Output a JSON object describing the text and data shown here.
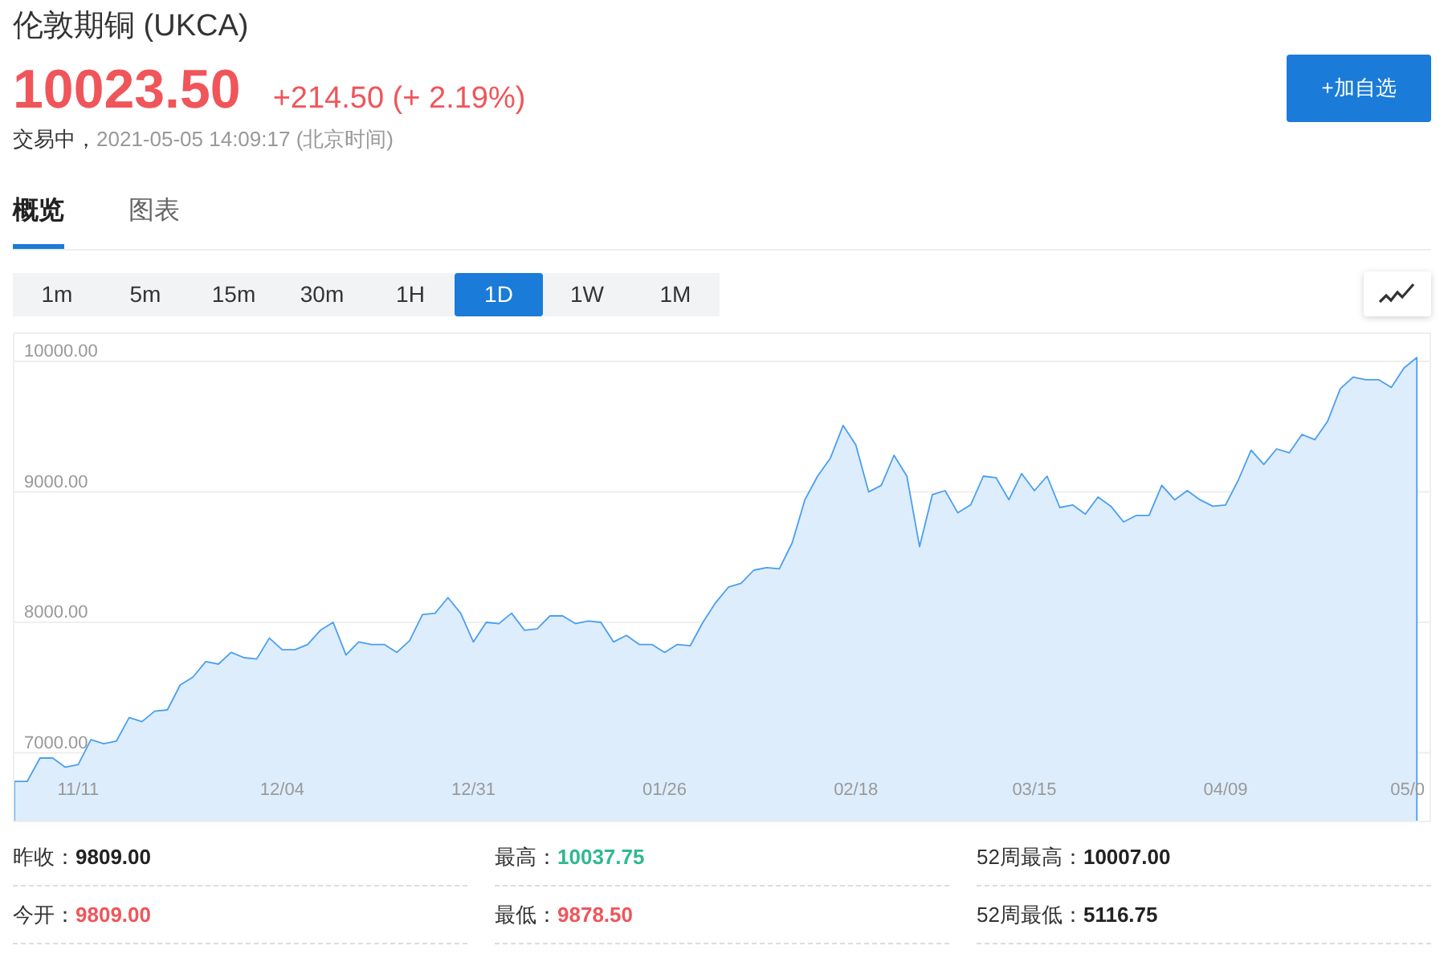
{
  "header": {
    "title": "伦敦期铜  (UKCA)",
    "price": "10023.50",
    "change": "+214.50 (+ 2.19%)",
    "status": "交易中，",
    "time": "2021-05-05 14:09:17  (北京时间)",
    "add_button": "+加自选"
  },
  "tabs": [
    {
      "label": "概览",
      "selected": true
    },
    {
      "label": "图表",
      "selected": false
    }
  ],
  "periods": [
    {
      "label": "1m",
      "selected": false
    },
    {
      "label": "5m",
      "selected": false
    },
    {
      "label": "15m",
      "selected": false
    },
    {
      "label": "30m",
      "selected": false
    },
    {
      "label": "1H",
      "selected": false
    },
    {
      "label": "1D",
      "selected": true
    },
    {
      "label": "1W",
      "selected": false
    },
    {
      "label": "1M",
      "selected": false
    }
  ],
  "chart": {
    "chart_data": {
      "type": "area",
      "categories": [
        null,
        null,
        null,
        null,
        null,
        "11/11",
        null,
        null,
        null,
        null,
        null,
        null,
        null,
        null,
        null,
        null,
        null,
        null,
        null,
        null,
        null,
        "12/04",
        null,
        null,
        null,
        null,
        null,
        null,
        null,
        null,
        null,
        null,
        null,
        null,
        null,
        null,
        "12/31",
        null,
        null,
        null,
        null,
        null,
        null,
        null,
        null,
        null,
        null,
        null,
        null,
        null,
        null,
        "01/26",
        null,
        null,
        null,
        null,
        null,
        null,
        null,
        null,
        null,
        null,
        null,
        null,
        null,
        null,
        "02/18",
        null,
        null,
        null,
        null,
        null,
        null,
        null,
        null,
        null,
        null,
        null,
        null,
        null,
        "03/15",
        null,
        null,
        null,
        null,
        null,
        null,
        null,
        null,
        null,
        null,
        null,
        null,
        null,
        null,
        "04/09",
        null,
        null,
        null,
        null,
        null,
        null,
        null,
        null,
        null,
        null,
        null,
        null,
        null,
        null,
        "05/0"
      ],
      "series": [
        {
          "color": "#4a9ff0",
          "values": [
            6780,
            6780,
            6960,
            6960,
            6890,
            6910,
            7100,
            7070,
            7090,
            7270,
            7240,
            7320,
            7330,
            7520,
            7580,
            7700,
            7680,
            7770,
            7730,
            7720,
            7880,
            7790,
            7790,
            7830,
            7940,
            8000,
            7750,
            7850,
            7830,
            7830,
            7770,
            7860,
            8060,
            8070,
            8190,
            8070,
            7850,
            8000,
            7990,
            8070,
            7940,
            7950,
            8050,
            8050,
            7990,
            8010,
            8000,
            7850,
            7900,
            7830,
            7830,
            7770,
            7830,
            7820,
            8000,
            8150,
            8270,
            8300,
            8400,
            8420,
            8410,
            8610,
            8940,
            9120,
            9260,
            9510,
            9360,
            9000,
            9050,
            9280,
            9120,
            8580,
            8980,
            9010,
            8840,
            8900,
            9120,
            9110,
            8940,
            9140,
            9010,
            9120,
            8880,
            8900,
            8830,
            8960,
            8890,
            8770,
            8820,
            8820,
            9050,
            8940,
            9010,
            8940,
            8890,
            8900,
            9090,
            9320,
            9210,
            9330,
            9300,
            9440,
            9400,
            9540,
            9790,
            9880,
            9860,
            9860,
            9800,
            9950,
            10030
          ]
        }
      ],
      "ylim": [
        6480,
        10210
      ],
      "grid": true,
      "yticks": [
        {
          "value": 7000,
          "label": "7000.00"
        },
        {
          "value": 8000,
          "label": "8000.00"
        },
        {
          "value": 9000,
          "label": "9000.00"
        },
        {
          "value": 10000,
          "label": "10000.00"
        }
      ]
    }
  },
  "stats": [
    {
      "label": "昨收：",
      "value": "9809.00",
      "color": "#222222"
    },
    {
      "label": "最高：",
      "value": "10037.75",
      "color": "#2fb98f"
    },
    {
      "label": "52周最高：",
      "value": "10007.00",
      "color": "#222222"
    },
    {
      "label": "今开：",
      "value": "9809.00",
      "color": "#f0555a"
    },
    {
      "label": "最低：",
      "value": "9878.50",
      "color": "#f0555a"
    },
    {
      "label": "52周最低：",
      "value": "5116.75",
      "color": "#222222"
    }
  ]
}
